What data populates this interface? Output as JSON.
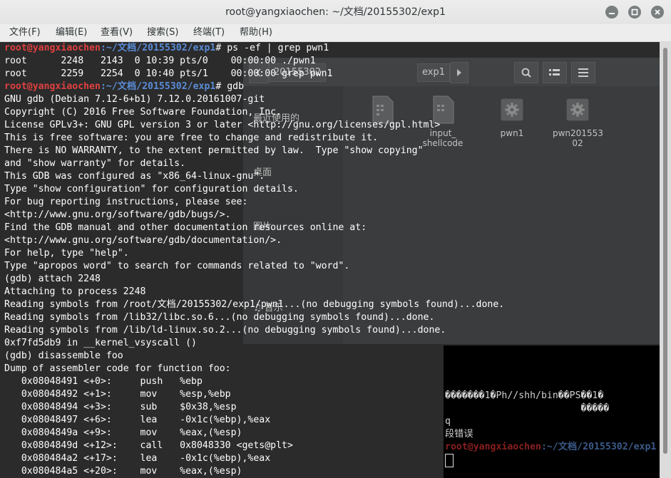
{
  "window": {
    "title": "root@yangxiaochen: ~/文档/20155302/exp1"
  },
  "menu": [
    "文件(F)",
    "编辑(E)",
    "查看(V)",
    "搜索(S)",
    "终端(T)",
    "帮助(H)"
  ],
  "prompt": {
    "user": "root@yangxiaochen",
    "path": ":~/文档/20155302/exp1"
  },
  "terminal": {
    "cmd1": "# ps -ef | grep pwn1",
    "ps_lines": [
      "root      2248   2143  0 10:39 pts/0    00:00:00 ./pwn1",
      "root      2259   2254  0 10:40 pts/1    00:00:00 grep pwn1"
    ],
    "cmd2": "# gdb",
    "output": [
      "GNU gdb (Debian 7.12-6+b1) 7.12.0.20161007-git",
      "Copyright (C) 2016 Free Software Foundation, Inc.",
      "License GPLv3+: GNU GPL version 3 or later <http://gnu.org/licenses/gpl.html>",
      "This is free software: you are free to change and redistribute it.",
      "There is NO WARRANTY, to the extent permitted by law.  Type \"show copying\"",
      "and \"show warranty\" for details.",
      "This GDB was configured as \"x86_64-linux-gnu\".",
      "Type \"show configuration\" for configuration details.",
      "For bug reporting instructions, please see:",
      "<http://www.gnu.org/software/gdb/bugs/>.",
      "Find the GDB manual and other documentation resources online at:",
      "<http://www.gnu.org/software/gdb/documentation/>.",
      "For help, type \"help\".",
      "Type \"apropos word\" to search for commands related to \"word\".",
      "(gdb) attach 2248",
      "Attaching to process 2248",
      "Reading symbols from /root/文档/20155302/exp1/pwn1...(no debugging symbols found)...done.",
      "Reading symbols from /lib32/libc.so.6...(no debugging symbols found)...done.",
      "Reading symbols from /lib/ld-linux.so.2...(no debugging symbols found)...done.",
      "0xf7fd5db9 in __kernel_vsyscall ()",
      "(gdb) disassemble foo",
      "Dump of assembler code for function foo:",
      "   0x08048491 <+0>:     push   %ebp",
      "   0x08048492 <+1>:     mov    %esp,%ebp",
      "   0x08048494 <+3>:     sub    $0x38,%esp",
      "   0x08048497 <+6>:     lea    -0x1c(%ebp),%eax",
      "   0x0804849a <+9>:     mov    %eax,(%esp)",
      "   0x0804849d <+12>:    call   0x8048330 <gets@plt>",
      "   0x080484a2 <+17>:    lea    -0x1c(%ebp),%eax",
      "   0x080484a5 <+20>:    mov    %eax,(%esp)"
    ]
  },
  "file_manager": {
    "breadcrumbs": [
      "20155302",
      "exp1"
    ],
    "sidebar": [
      "最近使用的",
      "桌面",
      "图片",
      "音乐"
    ],
    "files": [
      {
        "name": "input_\nshellcode",
        "icon": "document-icon"
      },
      {
        "name": "pwn1",
        "icon": "gear-icon"
      },
      {
        "name": "pwn201553\n02",
        "icon": "gear-icon"
      }
    ]
  },
  "terminal2": {
    "lines": [
      "�������1�Ph//shh/bin��PS��1�",
      "                        �����",
      "q",
      "段错误"
    ]
  },
  "colors": {
    "user": "#e04040",
    "path": "#5a8cd8",
    "terminal_bg": "#2b2b2b"
  }
}
